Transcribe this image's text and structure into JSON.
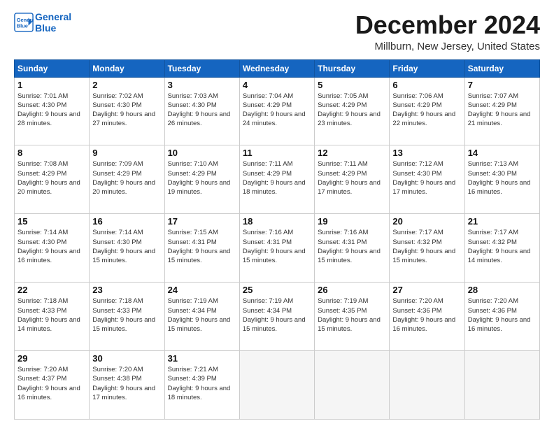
{
  "logo": {
    "line1": "General",
    "line2": "Blue"
  },
  "title": "December 2024",
  "subtitle": "Millburn, New Jersey, United States",
  "weekdays": [
    "Sunday",
    "Monday",
    "Tuesday",
    "Wednesday",
    "Thursday",
    "Friday",
    "Saturday"
  ],
  "weeks": [
    [
      {
        "day": 1,
        "sunrise": "7:01 AM",
        "sunset": "4:30 PM",
        "daylight": "9 hours and 28 minutes."
      },
      {
        "day": 2,
        "sunrise": "7:02 AM",
        "sunset": "4:30 PM",
        "daylight": "9 hours and 27 minutes."
      },
      {
        "day": 3,
        "sunrise": "7:03 AM",
        "sunset": "4:30 PM",
        "daylight": "9 hours and 26 minutes."
      },
      {
        "day": 4,
        "sunrise": "7:04 AM",
        "sunset": "4:29 PM",
        "daylight": "9 hours and 24 minutes."
      },
      {
        "day": 5,
        "sunrise": "7:05 AM",
        "sunset": "4:29 PM",
        "daylight": "9 hours and 23 minutes."
      },
      {
        "day": 6,
        "sunrise": "7:06 AM",
        "sunset": "4:29 PM",
        "daylight": "9 hours and 22 minutes."
      },
      {
        "day": 7,
        "sunrise": "7:07 AM",
        "sunset": "4:29 PM",
        "daylight": "9 hours and 21 minutes."
      }
    ],
    [
      {
        "day": 8,
        "sunrise": "7:08 AM",
        "sunset": "4:29 PM",
        "daylight": "9 hours and 20 minutes."
      },
      {
        "day": 9,
        "sunrise": "7:09 AM",
        "sunset": "4:29 PM",
        "daylight": "9 hours and 20 minutes."
      },
      {
        "day": 10,
        "sunrise": "7:10 AM",
        "sunset": "4:29 PM",
        "daylight": "9 hours and 19 minutes."
      },
      {
        "day": 11,
        "sunrise": "7:11 AM",
        "sunset": "4:29 PM",
        "daylight": "9 hours and 18 minutes."
      },
      {
        "day": 12,
        "sunrise": "7:11 AM",
        "sunset": "4:29 PM",
        "daylight": "9 hours and 17 minutes."
      },
      {
        "day": 13,
        "sunrise": "7:12 AM",
        "sunset": "4:30 PM",
        "daylight": "9 hours and 17 minutes."
      },
      {
        "day": 14,
        "sunrise": "7:13 AM",
        "sunset": "4:30 PM",
        "daylight": "9 hours and 16 minutes."
      }
    ],
    [
      {
        "day": 15,
        "sunrise": "7:14 AM",
        "sunset": "4:30 PM",
        "daylight": "9 hours and 16 minutes."
      },
      {
        "day": 16,
        "sunrise": "7:14 AM",
        "sunset": "4:30 PM",
        "daylight": "9 hours and 15 minutes."
      },
      {
        "day": 17,
        "sunrise": "7:15 AM",
        "sunset": "4:31 PM",
        "daylight": "9 hours and 15 minutes."
      },
      {
        "day": 18,
        "sunrise": "7:16 AM",
        "sunset": "4:31 PM",
        "daylight": "9 hours and 15 minutes."
      },
      {
        "day": 19,
        "sunrise": "7:16 AM",
        "sunset": "4:31 PM",
        "daylight": "9 hours and 15 minutes."
      },
      {
        "day": 20,
        "sunrise": "7:17 AM",
        "sunset": "4:32 PM",
        "daylight": "9 hours and 15 minutes."
      },
      {
        "day": 21,
        "sunrise": "7:17 AM",
        "sunset": "4:32 PM",
        "daylight": "9 hours and 14 minutes."
      }
    ],
    [
      {
        "day": 22,
        "sunrise": "7:18 AM",
        "sunset": "4:33 PM",
        "daylight": "9 hours and 14 minutes."
      },
      {
        "day": 23,
        "sunrise": "7:18 AM",
        "sunset": "4:33 PM",
        "daylight": "9 hours and 15 minutes."
      },
      {
        "day": 24,
        "sunrise": "7:19 AM",
        "sunset": "4:34 PM",
        "daylight": "9 hours and 15 minutes."
      },
      {
        "day": 25,
        "sunrise": "7:19 AM",
        "sunset": "4:34 PM",
        "daylight": "9 hours and 15 minutes."
      },
      {
        "day": 26,
        "sunrise": "7:19 AM",
        "sunset": "4:35 PM",
        "daylight": "9 hours and 15 minutes."
      },
      {
        "day": 27,
        "sunrise": "7:20 AM",
        "sunset": "4:36 PM",
        "daylight": "9 hours and 16 minutes."
      },
      {
        "day": 28,
        "sunrise": "7:20 AM",
        "sunset": "4:36 PM",
        "daylight": "9 hours and 16 minutes."
      }
    ],
    [
      {
        "day": 29,
        "sunrise": "7:20 AM",
        "sunset": "4:37 PM",
        "daylight": "9 hours and 16 minutes."
      },
      {
        "day": 30,
        "sunrise": "7:20 AM",
        "sunset": "4:38 PM",
        "daylight": "9 hours and 17 minutes."
      },
      {
        "day": 31,
        "sunrise": "7:21 AM",
        "sunset": "4:39 PM",
        "daylight": "9 hours and 18 minutes."
      },
      null,
      null,
      null,
      null
    ]
  ]
}
